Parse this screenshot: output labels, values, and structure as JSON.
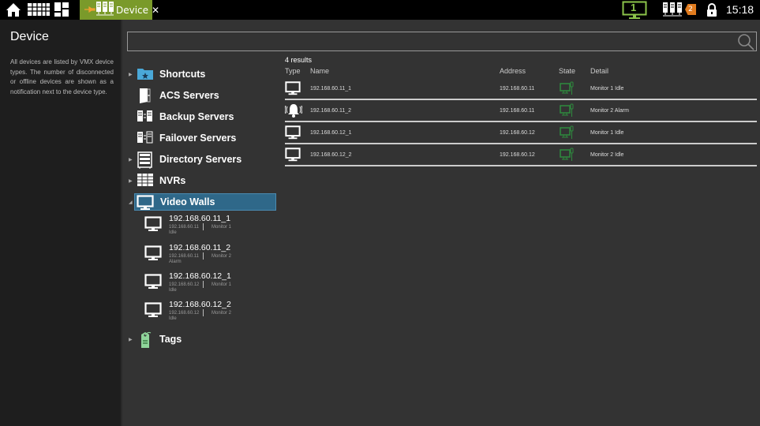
{
  "topbar": {
    "icons": [
      "home-icon",
      "video-grid-icon",
      "layout-icon"
    ],
    "tab": {
      "label": "Device",
      "close": "✕",
      "icons": [
        "pin-icon",
        "servers-icon"
      ]
    },
    "monitor_number": "1",
    "notification_count": "2",
    "time": "15:18"
  },
  "sidebar": {
    "title": "Device",
    "description": "All devices are listed by VMX device types. The number of disconnected or offline devices are shown as a notification next to the device type."
  },
  "search": {
    "placeholder": "",
    "value": ""
  },
  "tree": {
    "nodes": [
      {
        "label": "Shortcuts",
        "icon": "folder-star-icon",
        "expandable": true
      },
      {
        "label": "ACS Servers",
        "icon": "door-icon",
        "expandable": false
      },
      {
        "label": "Backup Servers",
        "icon": "backup-server-icon",
        "expandable": false
      },
      {
        "label": "Failover Servers",
        "icon": "failover-server-icon",
        "expandable": false
      },
      {
        "label": "Directory Servers",
        "icon": "directory-server-icon",
        "expandable": true
      },
      {
        "label": "NVRs",
        "icon": "nvr-icon",
        "expandable": true
      },
      {
        "label": "Video Walls",
        "icon": "monitor-icon",
        "expandable": true,
        "expanded": true,
        "selected": true
      },
      {
        "label": "Tags",
        "icon": "tag-icon",
        "expandable": true
      }
    ],
    "video_walls": [
      {
        "name": "192.168.60.11_1",
        "address": "192.168.60.11",
        "monitor": "Monitor 1",
        "state": "Idle"
      },
      {
        "name": "192.168.60.11_2",
        "address": "192.168.60.11",
        "monitor": "Monitor 2",
        "state": "Alarm"
      },
      {
        "name": "192.168.60.12_1",
        "address": "192.168.60.12",
        "monitor": "Monitor 1",
        "state": "Idle"
      },
      {
        "name": "192.168.60.12_2",
        "address": "192.168.60.12",
        "monitor": "Monitor 2",
        "state": "Idle"
      }
    ]
  },
  "results": {
    "count_label": "4 results",
    "columns": [
      "Type",
      "Name",
      "Address",
      "State",
      "Detail"
    ],
    "rows": [
      {
        "type_icon": "monitor-icon",
        "name": "192.168.60.11_1",
        "address": "192.168.60.11",
        "state_icon": "connected-monitor-icon",
        "detail": "Monitor 1  Idle"
      },
      {
        "type_icon": "alarm-bell-icon",
        "name": "192.168.60.11_2",
        "address": "192.168.60.11",
        "state_icon": "connected-monitor-icon",
        "detail": "Monitor 2  Alarm"
      },
      {
        "type_icon": "monitor-icon",
        "name": "192.168.60.12_1",
        "address": "192.168.60.12",
        "state_icon": "connected-monitor-icon",
        "detail": "Monitor 1  Idle"
      },
      {
        "type_icon": "monitor-icon",
        "name": "192.168.60.12_2",
        "address": "192.168.60.12",
        "state_icon": "connected-monitor-icon",
        "detail": "Monitor 2  Idle"
      }
    ]
  },
  "colors": {
    "accent_green": "#7a9a2a",
    "selection_blue": "#2f6889",
    "state_green": "#2e8b3e",
    "notification_orange": "#e07b1e"
  }
}
